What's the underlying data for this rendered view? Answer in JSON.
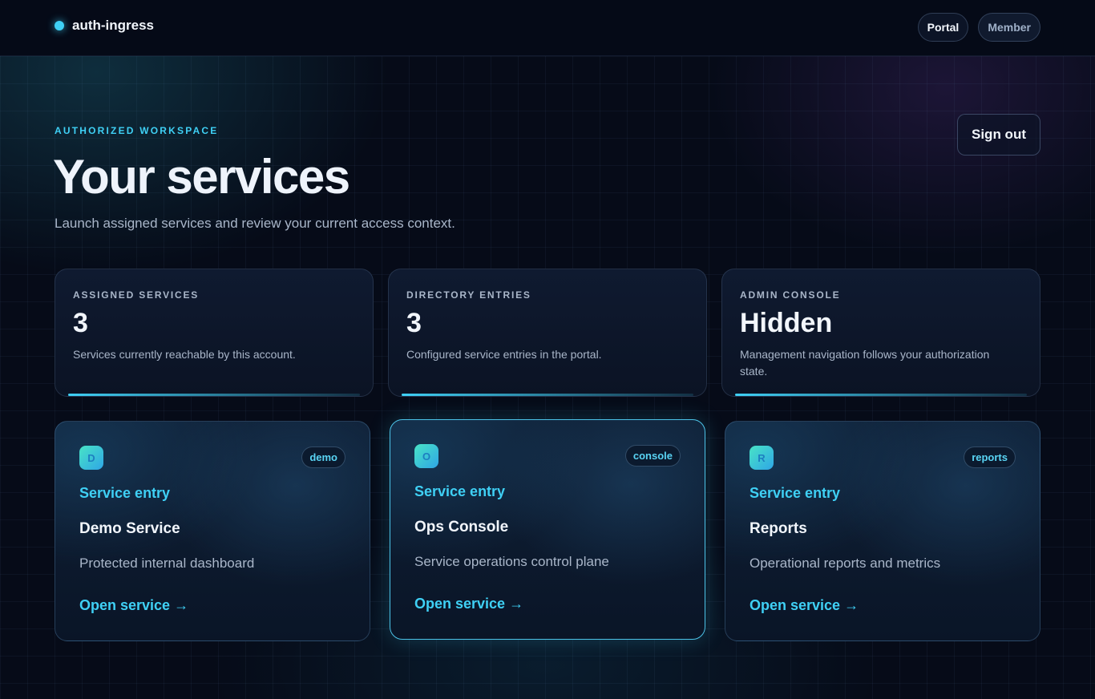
{
  "header": {
    "brand": "auth-ingress",
    "nav": {
      "portal": "Portal",
      "member": "Member"
    }
  },
  "hero": {
    "eyebrow": "AUTHORIZED WORKSPACE",
    "title": "Your services",
    "subtitle": "Launch assigned services and review your current access context.",
    "sign_out": "Sign out"
  },
  "stats": [
    {
      "label": "ASSIGNED SERVICES",
      "value": "3",
      "desc": "Services currently reachable by this account."
    },
    {
      "label": "DIRECTORY ENTRIES",
      "value": "3",
      "desc": "Configured service entries in the portal."
    },
    {
      "label": "ADMIN CONSOLE",
      "value": "Hidden",
      "desc": "Management navigation follows your authorization state."
    }
  ],
  "services": [
    {
      "icon": "D",
      "tag": "demo",
      "kicker": "Service entry",
      "name": "Demo Service",
      "desc": "Protected internal dashboard",
      "link": "Open service →"
    },
    {
      "icon": "O",
      "tag": "console",
      "kicker": "Service entry",
      "name": "Ops Console",
      "desc": "Service operations control plane",
      "link": "Open service →"
    },
    {
      "icon": "R",
      "tag": "reports",
      "kicker": "Service entry",
      "name": "Reports",
      "desc": "Operational reports and metrics",
      "link": "Open service →"
    }
  ],
  "colors": {
    "accent": "#3fd0f5",
    "background": "#060b18",
    "card_border_active": "#4cc3e8"
  }
}
